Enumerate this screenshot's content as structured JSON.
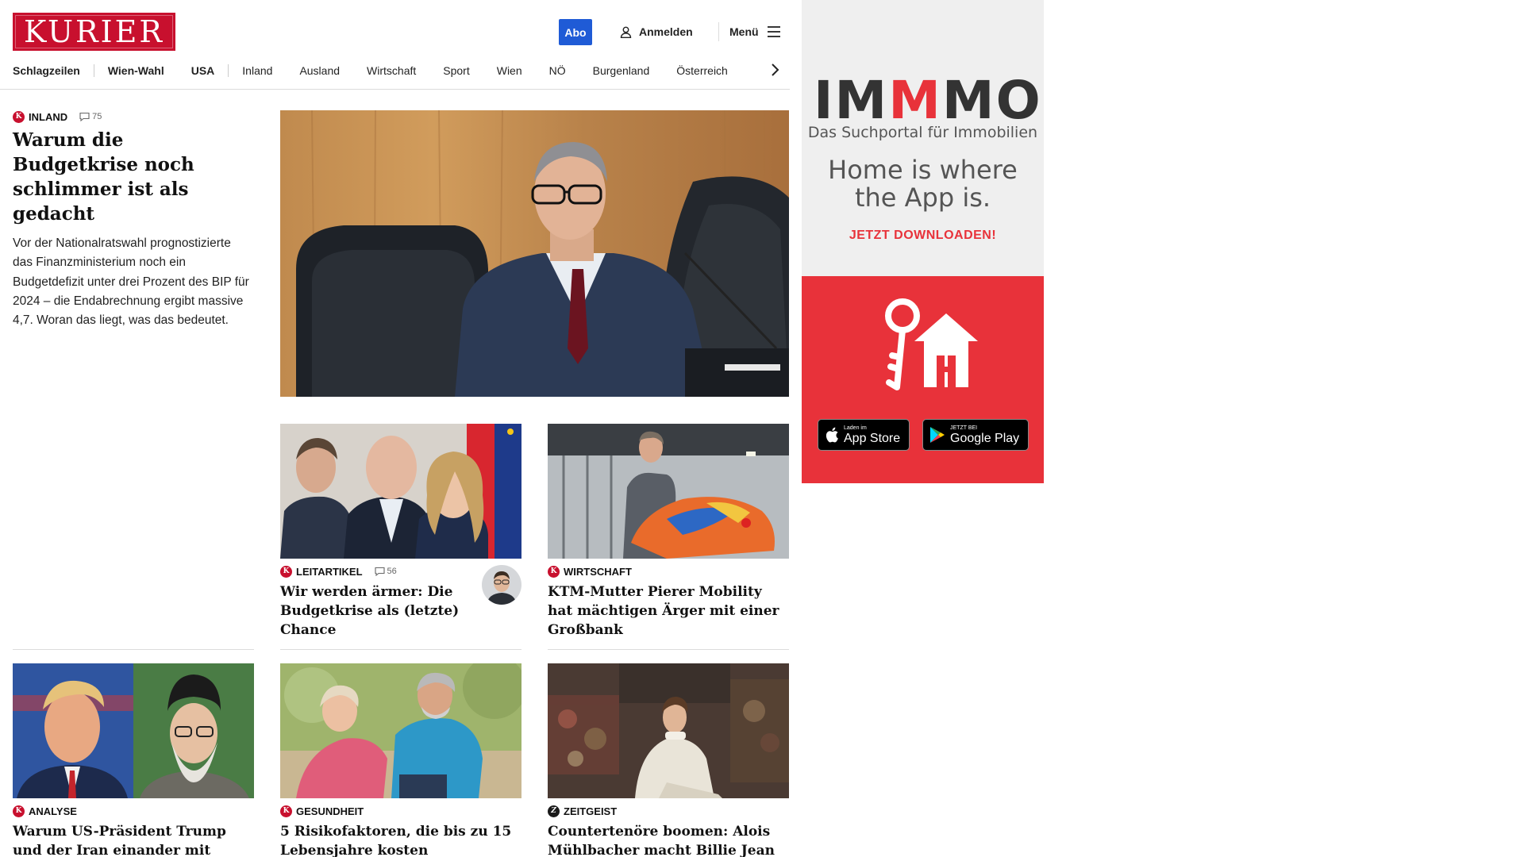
{
  "header": {
    "logo_text": "KURIER",
    "abo_label": "Abo",
    "login_label": "Anmelden",
    "menu_label": "Menü"
  },
  "nav": [
    "Schlagzeilen",
    "Wien-Wahl",
    "USA",
    "Inland",
    "Ausland",
    "Wirtschaft",
    "Sport",
    "Wien",
    "NÖ",
    "Burgenland",
    "Österreich"
  ],
  "lead": {
    "category": "Inland",
    "comments": "75",
    "title": "Warum die Budgetkrise noch schlimmer ist als gedacht",
    "teaser": "Vor der Nationalratswahl prognostizierte das Finanzministerium noch ein Budgetdefizit unter drei Prozent des BIP für 2024 – die Endabrechnung ergibt massive 4,7. Woran das liegt, was das bedeutet."
  },
  "cards": [
    {
      "category": "Leitartikel",
      "comments": "56",
      "title": "Wir werden ärmer: Die Budgetkrise als (letzte) Chance"
    },
    {
      "category": "Wirtschaft",
      "title": "KTM-Mutter Pierer Mobility hat mächtigen Ärger mit einer Großbank"
    },
    {
      "category": "Analyse",
      "title": "Warum US-Präsident Trump und der Iran einander mit Bomben drohen"
    },
    {
      "category": "Gesundheit",
      "title": "5 Risikofaktoren, die bis zu 15 Lebensjahre kosten"
    },
    {
      "category": "Zeitgeist",
      "title": "Countertenöre boomen: Alois Mühlbacher macht Billie Jean barock"
    }
  ],
  "ad": {
    "logo": {
      "pre": "IM",
      "m": "M",
      "post": "MO"
    },
    "subtitle": "Das Suchportal für Immobilien",
    "tagline_1": "Home is where",
    "tagline_2": "the App is.",
    "cta": "JETZT DOWNLOADEN!",
    "appstore_small": "Laden im",
    "appstore_big": "App Store",
    "googleplay_small": "JETZT BEI",
    "googleplay_big": "Google Play"
  },
  "colors": {
    "brand_red": "#c8102e",
    "abo_blue": "#1f5bd6",
    "ad_red": "#e8323a"
  }
}
